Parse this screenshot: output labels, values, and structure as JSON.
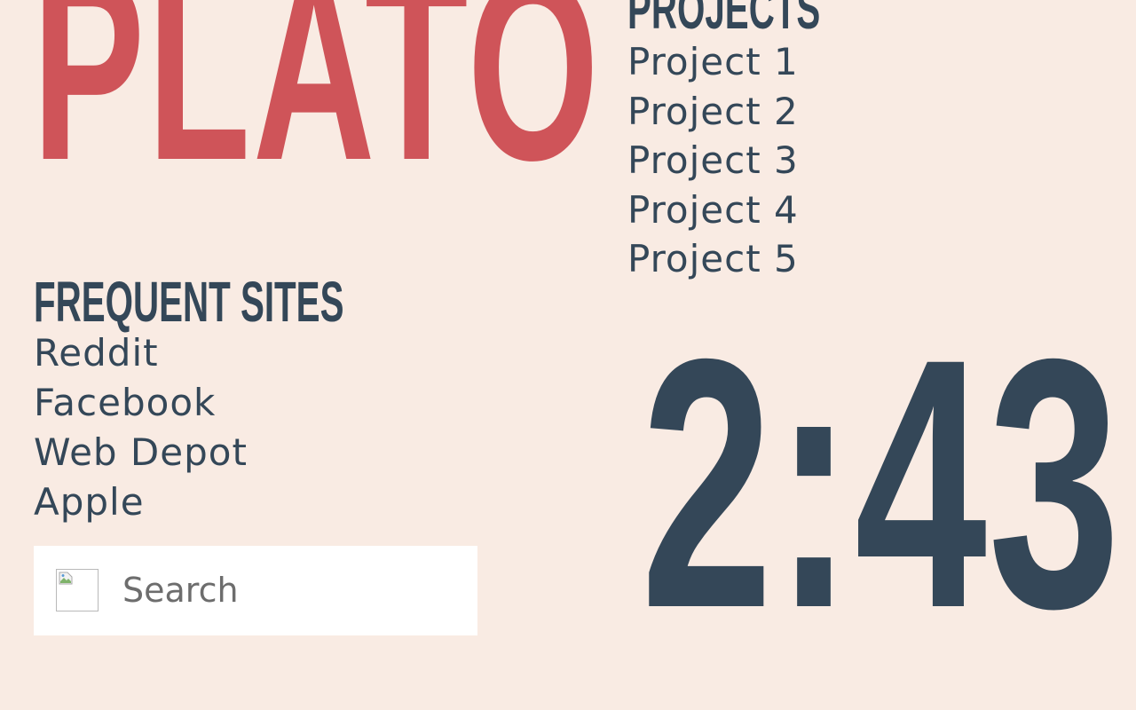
{
  "brand": {
    "title": "PLATO"
  },
  "projects": {
    "heading": "PROJECTS",
    "items": [
      {
        "label": "Project 1"
      },
      {
        "label": "Project 2"
      },
      {
        "label": "Project 3"
      },
      {
        "label": "Project 4"
      },
      {
        "label": "Project 5"
      }
    ]
  },
  "frequent_sites": {
    "heading": "FREQUENT SITES",
    "items": [
      {
        "label": "Reddit"
      },
      {
        "label": "Facebook"
      },
      {
        "label": "Web Depot"
      },
      {
        "label": "Apple"
      }
    ]
  },
  "search": {
    "placeholder": "Search",
    "value": "",
    "icon": "broken-image-icon"
  },
  "clock": {
    "time": "2:43"
  },
  "colors": {
    "background": "#f9ebe3",
    "accent": "#cf5459",
    "text": "#344758",
    "search_background": "#ffffff"
  }
}
